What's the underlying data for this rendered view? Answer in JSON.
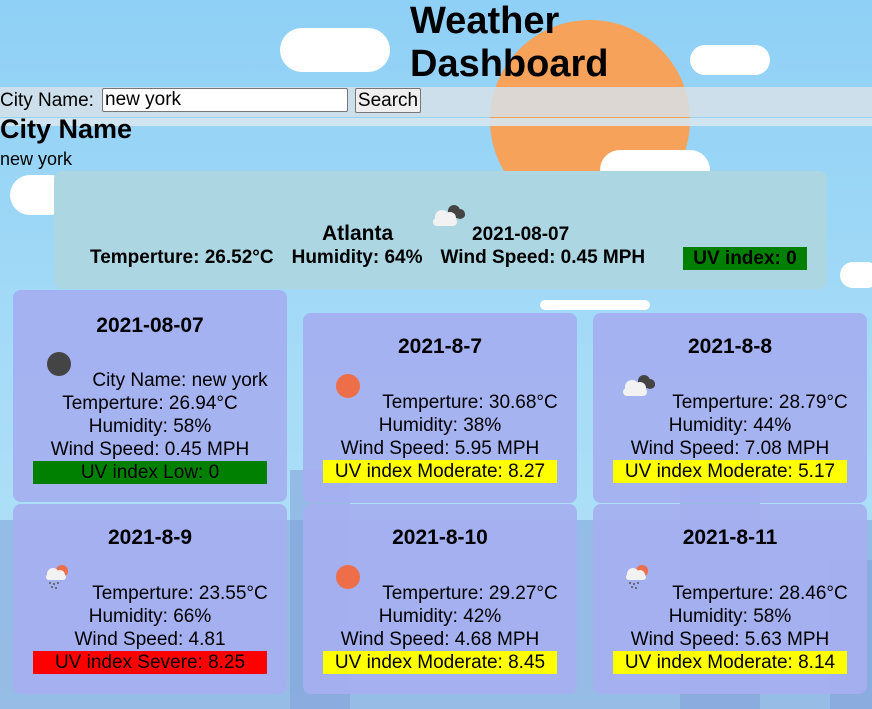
{
  "header": {
    "title": "Weather Dashboard"
  },
  "search": {
    "label": "City Name:",
    "value": "new york",
    "button_label": "Search"
  },
  "city_section": {
    "heading": "City Name",
    "value": "new york"
  },
  "current": {
    "city": "Atlanta",
    "date": "2021-08-07",
    "icon": "broken-clouds-icon",
    "temperature": "Temperture: 26.52°C",
    "humidity": "Humidity: 64%",
    "wind": "Wind Speed: 0.45 MPH",
    "uv": "UV index: 0",
    "uv_color": "#008000"
  },
  "forecast": [
    {
      "date": "2021-08-07",
      "icon": "dark-cloud-icon",
      "city_line": "City Name: new york",
      "temperature": "Temperture: 26.94°C",
      "humidity": "Humidity: 58%",
      "wind": "Wind Speed: 0.45 MPH",
      "uv": "UV index Low: 0",
      "uv_color": "#008000"
    },
    {
      "date": "2021-8-7",
      "icon": "sun-icon",
      "temperature": "Temperture: 30.68°C",
      "humidity": "Humidity: 38%",
      "wind": "Wind Speed: 5.95 MPH",
      "uv": "UV index Moderate: 8.27",
      "uv_color": "#ffff00"
    },
    {
      "date": "2021-8-8",
      "icon": "broken-clouds-icon",
      "temperature": "Temperture: 28.79°C",
      "humidity": "Humidity: 44%",
      "wind": "Wind Speed: 7.08 MPH",
      "uv": "UV index Moderate: 5.17",
      "uv_color": "#ffff00"
    },
    {
      "date": "2021-8-9",
      "icon": "rain-sun-icon",
      "temperature": "Temperture: 23.55°C",
      "humidity": "Humidity: 66%",
      "wind": "Wind Speed: 4.81",
      "uv": "UV index Severe: 8.25",
      "uv_color": "#ff0000"
    },
    {
      "date": "2021-8-10",
      "icon": "sun-icon",
      "temperature": "Temperture: 29.27°C",
      "humidity": "Humidity: 42%",
      "wind": "Wind Speed: 4.68 MPH",
      "uv": "UV index Moderate: 8.45",
      "uv_color": "#ffff00"
    },
    {
      "date": "2021-8-11",
      "icon": "rain-sun-icon",
      "temperature": "Temperture: 28.46°C",
      "humidity": "Humidity: 58%",
      "wind": "Wind Speed: 5.63 MPH",
      "uv": "UV index Moderate: 8.14",
      "uv_color": "#ffff00"
    }
  ]
}
